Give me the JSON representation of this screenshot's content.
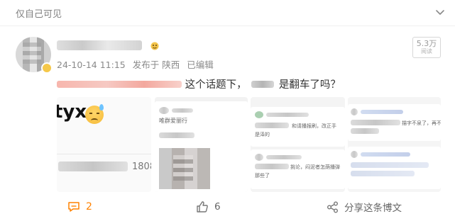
{
  "header": {
    "privacy_label": "仅自己可见",
    "menu_icon": "chevron-down-icon"
  },
  "post": {
    "timestamp": "24-10-14 11:15",
    "source": "发布于 陕西",
    "edited": "已编辑",
    "text_mid": "这个话题下，",
    "text_end": "是翻车了吗？",
    "views_num": "5.3万",
    "views_label": "阅读"
  },
  "thumbnails": {
    "t1_big": "tyx",
    "t1_count": "1808",
    "t2_line": "唯群爱丽行",
    "t3_line1": "和请播报刷，改正手",
    "t3_line2": "是泽的",
    "t3_line3": "那些了",
    "t3_line4": "挑论，闷泥者怎荫播弹",
    "t4_line1": "描字不泉了，再不能"
  },
  "actions": {
    "comment_count": "2",
    "like_count": "6",
    "share_label": "分享这条博文"
  },
  "colors": {
    "accent_orange": "#ff8200",
    "meta_grey": "#8a8a8a"
  }
}
